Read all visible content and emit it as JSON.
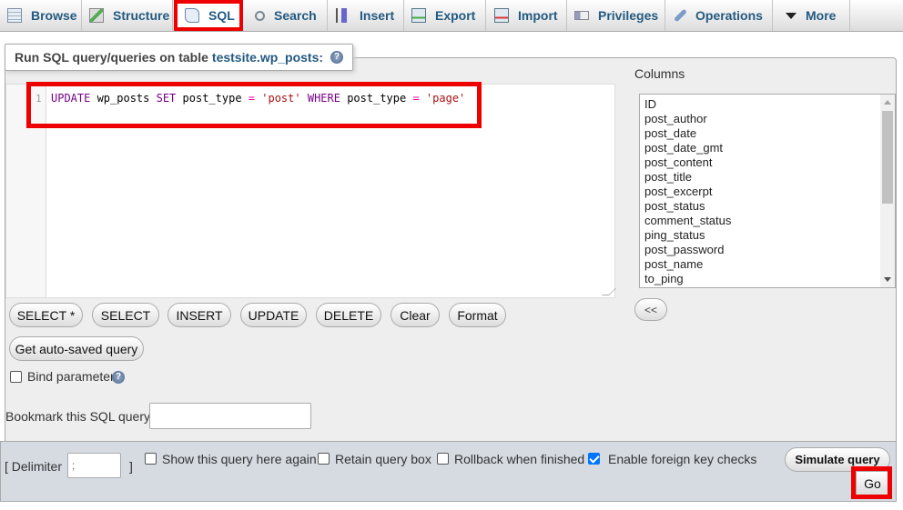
{
  "tabs": [
    {
      "label": "Browse",
      "icon": "browse-icon"
    },
    {
      "label": "Structure",
      "icon": "structure-icon"
    },
    {
      "label": "SQL",
      "icon": "sql-icon",
      "active": true
    },
    {
      "label": "Search",
      "icon": "search-icon"
    },
    {
      "label": "Insert",
      "icon": "insert-icon"
    },
    {
      "label": "Export",
      "icon": "export-icon"
    },
    {
      "label": "Import",
      "icon": "import-icon"
    },
    {
      "label": "Privileges",
      "icon": "privileges-icon"
    },
    {
      "label": "Operations",
      "icon": "wrench-icon"
    },
    {
      "label": "More",
      "icon": "triangle-down-icon"
    }
  ],
  "legend": {
    "prefix": "Run SQL query/queries on table",
    "table": "testsite.wp_posts:"
  },
  "editor": {
    "line_number": "1",
    "tokens": {
      "k1": "UPDATE",
      "t1": " wp_posts ",
      "k2": "SET",
      "t2": " post_type ",
      "o1": "=",
      "s1": "'post'",
      "k3": "WHERE",
      "t3": " post_type ",
      "o2": "=",
      "s2": "'page'"
    },
    "query": "UPDATE wp_posts SET post_type = 'post' WHERE post_type = 'page'"
  },
  "query_buttons": [
    "SELECT *",
    "SELECT",
    "INSERT",
    "UPDATE",
    "DELETE",
    "Clear",
    "Format"
  ],
  "autosave_button": "Get auto-saved query",
  "bind_parameters": {
    "label": "Bind parameters",
    "checked": false
  },
  "columns": {
    "header": "Columns",
    "items": [
      "ID",
      "post_author",
      "post_date",
      "post_date_gmt",
      "post_content",
      "post_title",
      "post_excerpt",
      "post_status",
      "comment_status",
      "ping_status",
      "post_password",
      "post_name",
      "to_ping"
    ],
    "insert_button": "<<"
  },
  "bookmark": {
    "label": "Bookmark this SQL query:",
    "value": ""
  },
  "footer": {
    "delimiter_label": "[ Delimiter",
    "delimiter_value": ";",
    "delimiter_close": "]",
    "options": [
      {
        "label": "Show this query here again",
        "checked": false
      },
      {
        "label": "Retain query box",
        "checked": false
      },
      {
        "label": "Rollback when finished",
        "checked": false
      },
      {
        "label": "Enable foreign key checks",
        "checked": true
      }
    ],
    "simulate_button": "Simulate query",
    "go_button": "Go"
  }
}
